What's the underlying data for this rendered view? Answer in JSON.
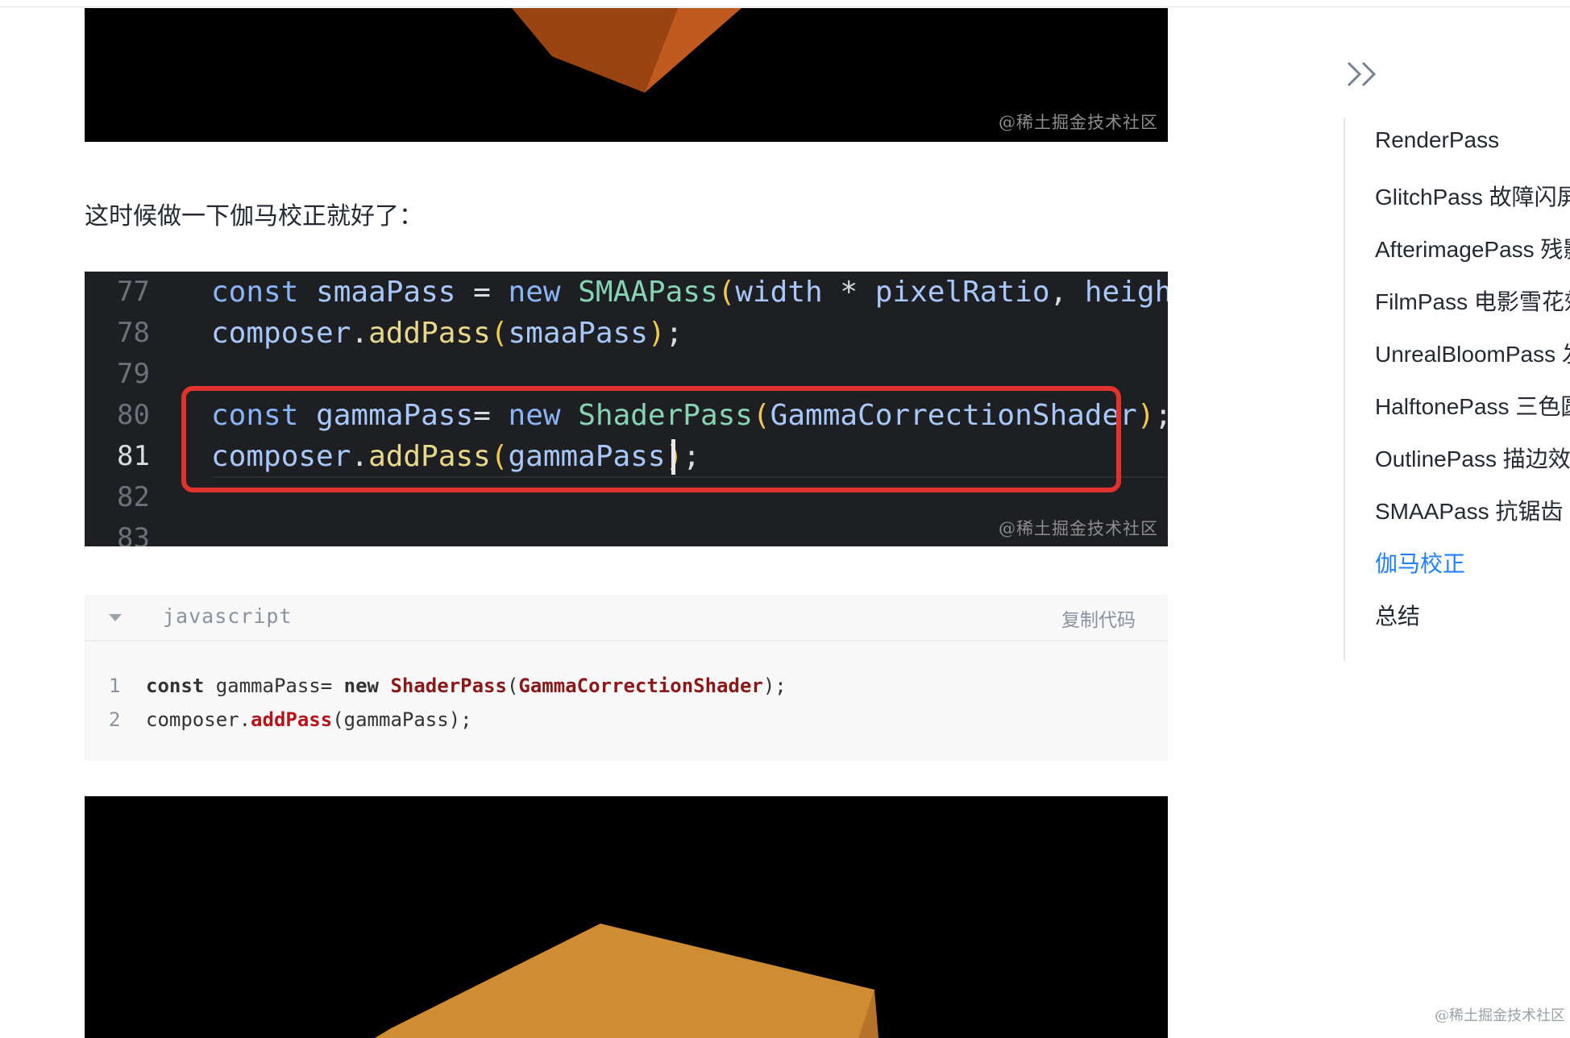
{
  "images": {
    "top_watermark": "@稀土掘金技术社区",
    "editor_watermark": "@稀土掘金技术社区"
  },
  "article": {
    "paragraph": "这时候做一下伽马校正就好了："
  },
  "editor": {
    "line_numbers": [
      "77",
      "78",
      "79",
      "80",
      "81",
      "82",
      "83"
    ],
    "active_line": "81"
  },
  "code_block": {
    "language": "javascript",
    "copy_label": "复制代码",
    "line_numbers": [
      "1",
      "2"
    ]
  },
  "toc": {
    "items": [
      {
        "label": "RenderPass",
        "active": false
      },
      {
        "label": "GlitchPass 故障闪屏",
        "active": false
      },
      {
        "label": "AfterimagePass 残影",
        "active": false
      },
      {
        "label": "FilmPass 电影雪花效果",
        "active": false
      },
      {
        "label": "UnrealBloomPass 发光",
        "active": false
      },
      {
        "label": "HalftonePass 三色圆点",
        "active": false
      },
      {
        "label": "OutlinePass 描边效果",
        "active": false
      },
      {
        "label": "SMAAPass 抗锯齿",
        "active": false
      },
      {
        "label": "伽马校正",
        "active": true
      },
      {
        "label": "总结",
        "active": false
      }
    ],
    "active_color": "#1e80ff"
  },
  "page_watermark": "@稀土掘金技术社区"
}
